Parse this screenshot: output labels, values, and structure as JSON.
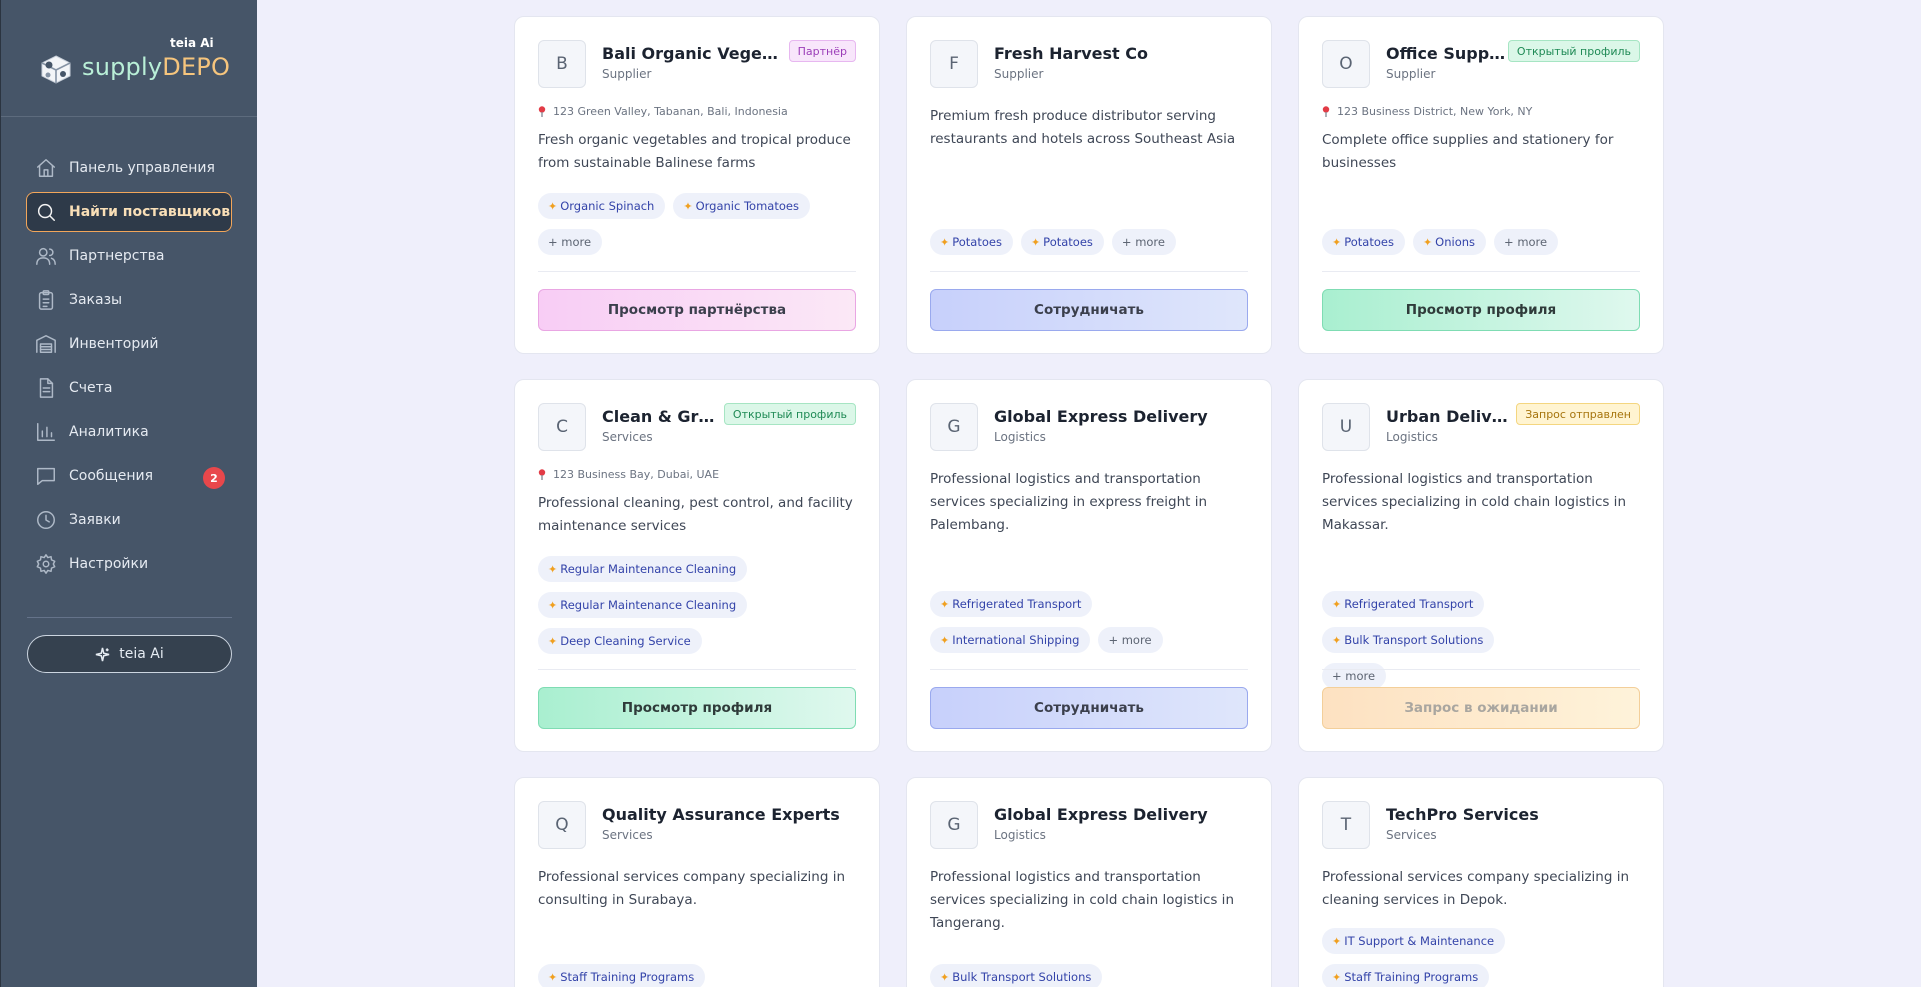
{
  "brand": {
    "tag": "teia Ai",
    "name_part1": "supply",
    "name_part2": "DEPO"
  },
  "nav": [
    {
      "label": "Панель управления",
      "icon": "home-icon"
    },
    {
      "label": "Найти поставщиков",
      "icon": "search-icon",
      "active": true
    },
    {
      "label": "Партнерства",
      "icon": "users-icon"
    },
    {
      "label": "Заказы",
      "icon": "clipboard-icon"
    },
    {
      "label": "Инвенторий",
      "icon": "warehouse-icon"
    },
    {
      "label": "Счета",
      "icon": "invoice-icon"
    },
    {
      "label": "Аналитика",
      "icon": "bar-chart-icon"
    },
    {
      "label": "Сообщения",
      "icon": "message-icon",
      "badge": "2"
    },
    {
      "label": "Заявки",
      "icon": "clock-icon"
    },
    {
      "label": "Настройки",
      "icon": "gear-icon"
    }
  ],
  "ai_button": {
    "label": "teia Ai",
    "icon": "sparkles-icon"
  },
  "cards": [
    {
      "letter": "B",
      "name": "Bali Organic Vegetables",
      "category": "Supplier",
      "badge": "Партнёр",
      "location": "123 Green Valley, Tabanan, Bali, Indonesia",
      "description": "Fresh organic vegetables and tropical produce from sustainable Balinese farms",
      "tags": [
        "Organic Spinach",
        "Organic Tomatoes"
      ],
      "more": "+ more",
      "action": "Просмотр партнёрства"
    },
    {
      "letter": "F",
      "name": "Fresh Harvest Co",
      "category": "Supplier",
      "description": "Premium fresh produce distributor serving restaurants and hotels across Southeast Asia",
      "tags": [
        "Potatoes",
        "Potatoes"
      ],
      "more": "+ more",
      "action": "Сотрудничать"
    },
    {
      "letter": "O",
      "name": "Office Supplies Plus",
      "category": "Supplier",
      "badge": "Открытый профиль",
      "location": "123 Business District, New York, NY",
      "description": "Complete office supplies and stationery for businesses",
      "tags": [
        "Potatoes",
        "Onions"
      ],
      "more": "+ more",
      "action": "Просмотр профиля"
    },
    {
      "letter": "C",
      "name": "Clean & Green Services",
      "category": "Services",
      "badge": "Открытый профиль",
      "location": "123 Business Bay, Dubai, UAE",
      "description": "Professional cleaning, pest control, and facility maintenance services",
      "tags": [
        "Regular Maintenance Cleaning",
        "Regular Maintenance Cleaning",
        "Deep Cleaning Service"
      ],
      "action": "Просмотр профиля"
    },
    {
      "letter": "G",
      "name": "Global Express Delivery",
      "category": "Logistics",
      "description": "Professional logistics and transportation services specializing in express freight in Palembang.",
      "tags": [
        "Refrigerated Transport",
        "International Shipping"
      ],
      "more": "+ more",
      "action": "Сотрудничать"
    },
    {
      "letter": "U",
      "name": "Urban Delivery Solutions",
      "category": "Logistics",
      "badge": "Запрос отправлен",
      "description": "Professional logistics and transportation services specializing in cold chain logistics in Makassar.",
      "tags": [
        "Refrigerated Transport",
        "Bulk Transport Solutions"
      ],
      "more": "+ more",
      "action": "Запрос в ожидании"
    },
    {
      "letter": "Q",
      "name": "Quality Assurance Experts",
      "category": "Services",
      "description": "Professional services company specializing in consulting in Surabaya.",
      "tags": [
        "Staff Training Programs"
      ]
    },
    {
      "letter": "G",
      "name": "Global Express Delivery",
      "category": "Logistics",
      "description": "Professional logistics and transportation services specializing in cold chain logistics in Tangerang.",
      "tags": [
        "Bulk Transport Solutions"
      ]
    },
    {
      "letter": "T",
      "name": "TechPro Services",
      "category": "Services",
      "description": "Professional services company specializing in cleaning services in Depok.",
      "tags": [
        "IT Support & Maintenance",
        "Staff Training Programs"
      ]
    }
  ]
}
